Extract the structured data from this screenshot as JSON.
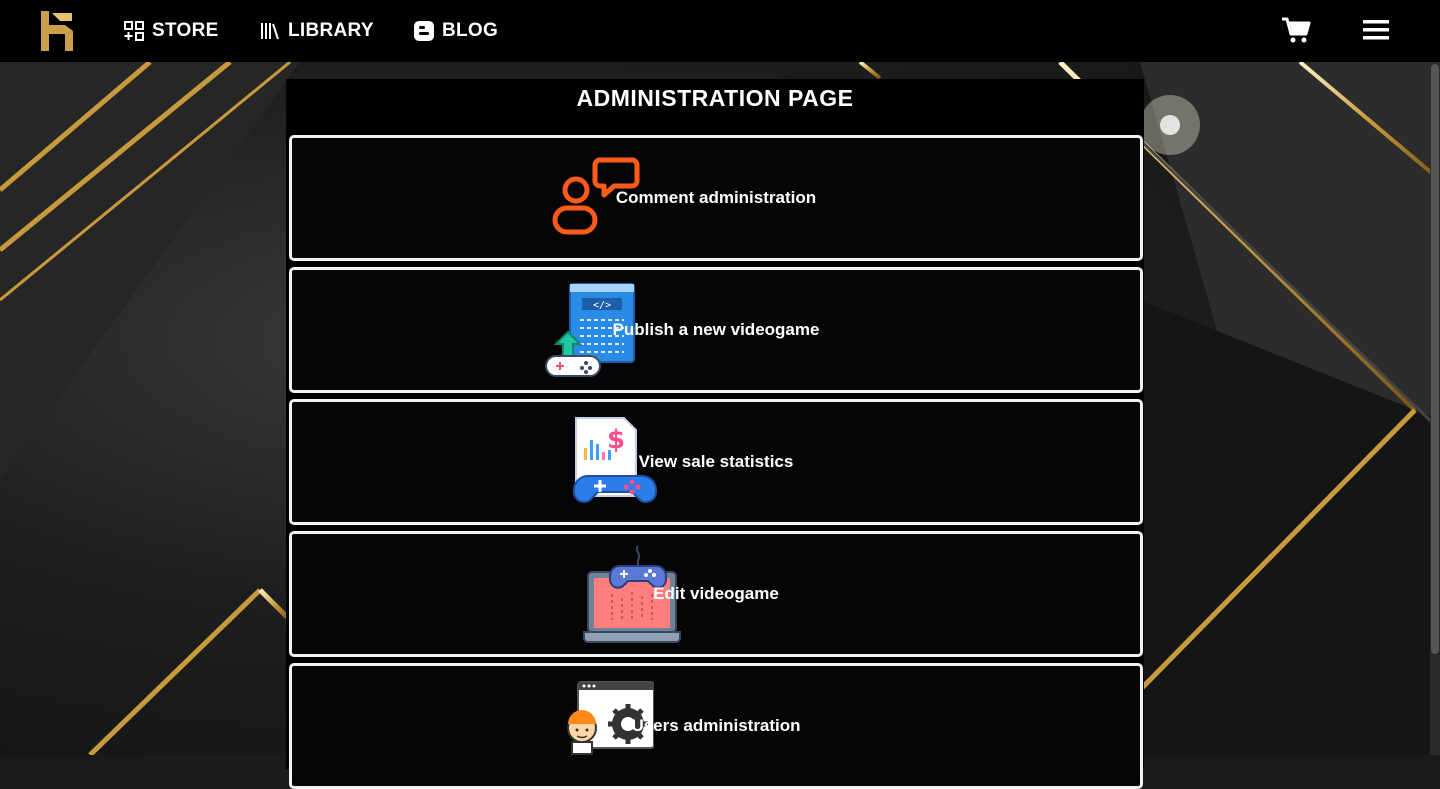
{
  "nav": {
    "items": [
      {
        "label": "STORE",
        "icon": "store-grid-icon"
      },
      {
        "label": "LIBRARY",
        "icon": "library-books-icon"
      },
      {
        "label": "BLOG",
        "icon": "blogger-icon"
      }
    ],
    "cart_icon": "shopping-cart-icon",
    "menu_icon": "hamburger-menu-icon"
  },
  "page": {
    "title": "ADMINISTRATION PAGE"
  },
  "cards": [
    {
      "label": "Comment administration",
      "icon": "comment-admin-icon"
    },
    {
      "label": "Publish a new videogame",
      "icon": "publish-videogame-icon"
    },
    {
      "label": "View sale statistics",
      "icon": "sale-statistics-icon"
    },
    {
      "label": "Edit videogame",
      "icon": "edit-videogame-icon"
    },
    {
      "label": "Users administration",
      "icon": "users-admin-icon"
    }
  ],
  "colors": {
    "accent_gold": "#d4aa52",
    "comment_orange": "#ff5a1a",
    "background": "#000000"
  }
}
